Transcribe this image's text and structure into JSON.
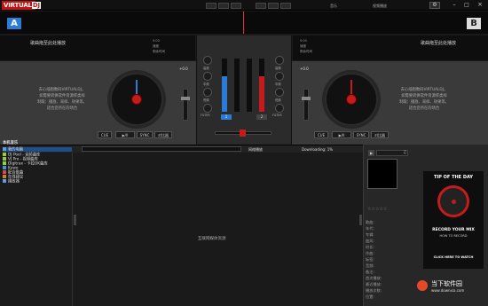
{
  "app": {
    "logo_part1": "VIRTUAL",
    "logo_part2": "DJ",
    "top_right_label1": "音乐",
    "top_right_label2": "视频播放"
  },
  "decks": {
    "a": {
      "badge": "A",
      "title": "歌曲拖至此处播放",
      "side_labels": [
        "5:00",
        "速度",
        "剩余时间"
      ],
      "help_text_l1": "去心插图数码VIRTUALDJ，",
      "help_text_l2": "如需要转换软件资源库类样",
      "help_text_l3": "制取：播放、采样、效果等，",
      "help_text_l4": "适合您所在的场合",
      "gain_label": "+0.0",
      "buttons": [
        "CUE",
        "▶/II",
        "SYNC",
        "对比器"
      ]
    },
    "b": {
      "badge": "B",
      "title": "歌曲拖至此处播放",
      "side_labels": [
        "5:00",
        "速度",
        "剩余时间"
      ],
      "help_text_l1": "去心插图数码VIRTUALDJ，",
      "help_text_l2": "如需要转换软件资源库类样",
      "help_text_l3": "制取：播放、采样、效果等，",
      "help_text_l4": "适合您所在的场合",
      "gain_label": "+0.0",
      "buttons": [
        "CUE",
        "▶/II",
        "SYNC",
        "对比器"
      ]
    }
  },
  "mixer": {
    "knob_labels_left": [
      "高频",
      "中频",
      "低频"
    ],
    "knob_labels_right": [
      "高频",
      "中频",
      "低频"
    ],
    "filter_label": "FILTER",
    "channel_a": "1",
    "channel_b": "2"
  },
  "browser": {
    "search_placeholder": "",
    "online_label": "网络播放",
    "downloading": "Downloading: 1%",
    "center_message": "互联网媒体资源"
  },
  "folders": [
    "本机音乐",
    "我的电脑",
    "DJ Pool - 音频曲库",
    "VJ Pro - 视频曲库",
    "Digitrax - 卡拉OK曲库",
    "Kuwo",
    "配合歌曲",
    "在线建议",
    "播放器"
  ],
  "sidebar": {
    "tip_title": "TIP OF THE DAY",
    "tip_l1": "RECORD YOUR MIX",
    "tip_l2": "HOW TO RECORD",
    "tip_button": "CLICK HERE TO WATCH",
    "rating": "☆☆☆☆☆",
    "meta_labels": [
      "歌曲:",
      "年代:",
      "专辑:",
      "曲风:",
      "时长:",
      "作曲:",
      "标签:",
      "音频:",
      "备注:",
      "首次播放:",
      "最近播放:",
      "播放次数:",
      "位置:"
    ],
    "watermark": "当下软件园",
    "watermark_url": "www.downxia.com"
  },
  "colors": {
    "deck_a": "#2c7bd6",
    "accent_red": "#c51b1b",
    "panel": "#3a3a3a"
  }
}
